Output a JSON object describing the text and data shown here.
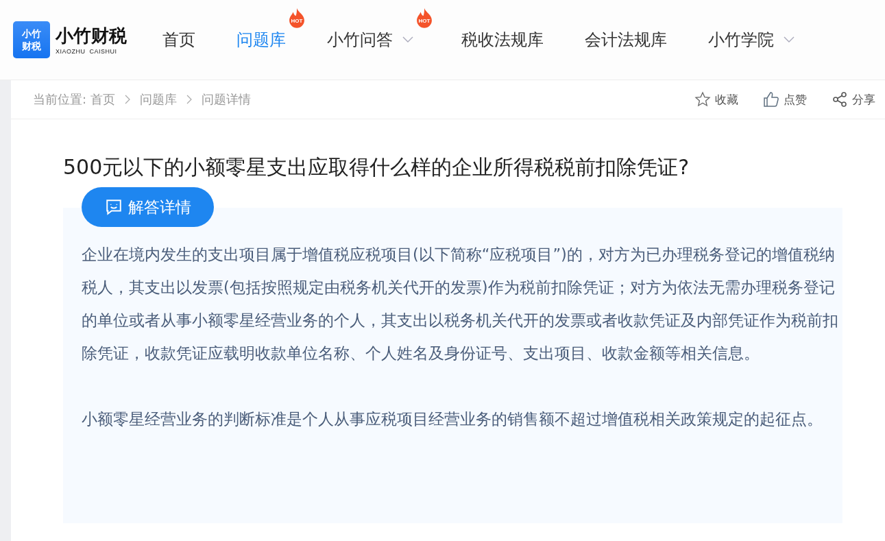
{
  "logo": {
    "mark_lines": [
      "小竹",
      "财税"
    ],
    "name": "小竹财税",
    "subtitle": "XIAOZHU  CAISHUI"
  },
  "nav": [
    {
      "label": "首页",
      "selected": false,
      "dropdown": false
    },
    {
      "label": "问题库",
      "selected": true,
      "badge": "HOT",
      "dropdown": false
    },
    {
      "label": "小竹问答",
      "selected": false,
      "badge": "HOT",
      "dropdown": true
    },
    {
      "label": "税收法规库",
      "selected": false,
      "dropdown": false
    },
    {
      "label": "会计法规库",
      "selected": false,
      "dropdown": false
    },
    {
      "label": "小竹学院",
      "selected": false,
      "dropdown": true
    }
  ],
  "breadcrumb": {
    "prefix": "当前位置:",
    "items": [
      "首页",
      "问题库",
      "问题详情"
    ]
  },
  "actions": [
    {
      "kind": "star",
      "label": "收藏"
    },
    {
      "kind": "like",
      "label": "点赞"
    },
    {
      "kind": "share",
      "label": "分享"
    }
  ],
  "question": {
    "title": "500元以下的小额零星支出应取得什么样的企业所得税税前扣除凭证?"
  },
  "answer": {
    "button": "解答详情",
    "paragraphs": [
      "企业在境内发生的支出项目属于增值税应税项目(以下简称“应税项目”)的，对方为已办理税务登记的增值税纳税人，其支出以发票(包括按照规定由税务机关代开的发票)作为税前扣除凭证；对方为依法无需办理税务登记的单位或者从事小额零星经营业务的个人，其支出以税务机关代开的发票或者收款凭证及内部凭证作为税前扣除凭证，收款凭证应载明收款单位名称、个人姓名及身份证号、支出项目、收款金额等相关信息。",
      "小额零星经营业务的判断标准是个人从事应税项目经营业务的销售额不超过增值税相关政策规定的起征点。"
    ]
  }
}
